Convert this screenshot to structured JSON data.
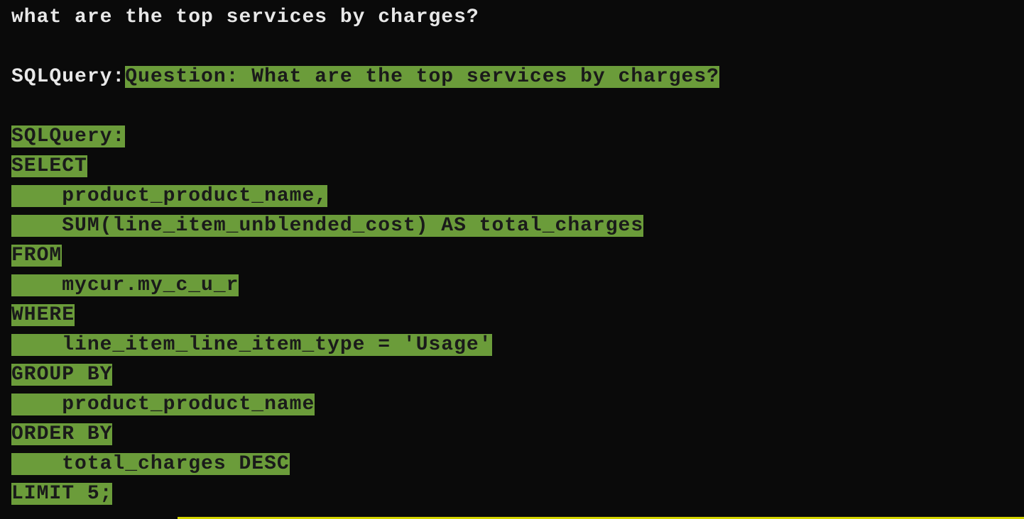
{
  "prompt": "what are the top services by charges?",
  "label_sqlquery": "SQLQuery:",
  "highlighted_question": "Question: What are the top services by charges?",
  "sql": {
    "header": "SQLQuery:",
    "select": "SELECT",
    "select_col1": "product_product_name,",
    "select_col2": "SUM(line_item_unblended_cost) AS total_charges",
    "from": "FROM",
    "from_table": "mycur.my_c_u_r",
    "where": "WHERE",
    "where_cond": "line_item_line_item_type = 'Usage'",
    "groupby": "GROUP BY",
    "groupby_col": "product_product_name",
    "orderby": "ORDER BY",
    "orderby_col": "total_charges DESC",
    "limit": "LIMIT 5;"
  }
}
